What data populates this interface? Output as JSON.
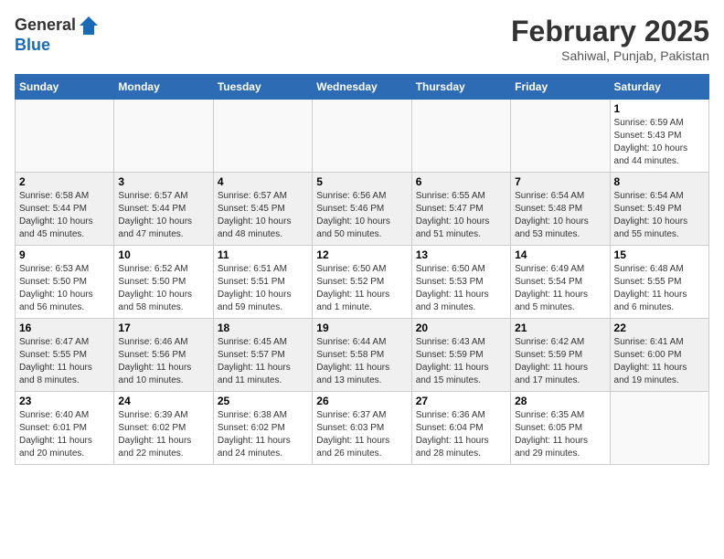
{
  "header": {
    "logo_general": "General",
    "logo_blue": "Blue",
    "month_title": "February 2025",
    "location": "Sahiwal, Punjab, Pakistan"
  },
  "days_of_week": [
    "Sunday",
    "Monday",
    "Tuesday",
    "Wednesday",
    "Thursday",
    "Friday",
    "Saturday"
  ],
  "weeks": [
    {
      "shaded": false,
      "days": [
        {
          "num": "",
          "info": ""
        },
        {
          "num": "",
          "info": ""
        },
        {
          "num": "",
          "info": ""
        },
        {
          "num": "",
          "info": ""
        },
        {
          "num": "",
          "info": ""
        },
        {
          "num": "",
          "info": ""
        },
        {
          "num": "1",
          "info": "Sunrise: 6:59 AM\nSunset: 5:43 PM\nDaylight: 10 hours\nand 44 minutes."
        }
      ]
    },
    {
      "shaded": true,
      "days": [
        {
          "num": "2",
          "info": "Sunrise: 6:58 AM\nSunset: 5:44 PM\nDaylight: 10 hours\nand 45 minutes."
        },
        {
          "num": "3",
          "info": "Sunrise: 6:57 AM\nSunset: 5:44 PM\nDaylight: 10 hours\nand 47 minutes."
        },
        {
          "num": "4",
          "info": "Sunrise: 6:57 AM\nSunset: 5:45 PM\nDaylight: 10 hours\nand 48 minutes."
        },
        {
          "num": "5",
          "info": "Sunrise: 6:56 AM\nSunset: 5:46 PM\nDaylight: 10 hours\nand 50 minutes."
        },
        {
          "num": "6",
          "info": "Sunrise: 6:55 AM\nSunset: 5:47 PM\nDaylight: 10 hours\nand 51 minutes."
        },
        {
          "num": "7",
          "info": "Sunrise: 6:54 AM\nSunset: 5:48 PM\nDaylight: 10 hours\nand 53 minutes."
        },
        {
          "num": "8",
          "info": "Sunrise: 6:54 AM\nSunset: 5:49 PM\nDaylight: 10 hours\nand 55 minutes."
        }
      ]
    },
    {
      "shaded": false,
      "days": [
        {
          "num": "9",
          "info": "Sunrise: 6:53 AM\nSunset: 5:50 PM\nDaylight: 10 hours\nand 56 minutes."
        },
        {
          "num": "10",
          "info": "Sunrise: 6:52 AM\nSunset: 5:50 PM\nDaylight: 10 hours\nand 58 minutes."
        },
        {
          "num": "11",
          "info": "Sunrise: 6:51 AM\nSunset: 5:51 PM\nDaylight: 10 hours\nand 59 minutes."
        },
        {
          "num": "12",
          "info": "Sunrise: 6:50 AM\nSunset: 5:52 PM\nDaylight: 11 hours\nand 1 minute."
        },
        {
          "num": "13",
          "info": "Sunrise: 6:50 AM\nSunset: 5:53 PM\nDaylight: 11 hours\nand 3 minutes."
        },
        {
          "num": "14",
          "info": "Sunrise: 6:49 AM\nSunset: 5:54 PM\nDaylight: 11 hours\nand 5 minutes."
        },
        {
          "num": "15",
          "info": "Sunrise: 6:48 AM\nSunset: 5:55 PM\nDaylight: 11 hours\nand 6 minutes."
        }
      ]
    },
    {
      "shaded": true,
      "days": [
        {
          "num": "16",
          "info": "Sunrise: 6:47 AM\nSunset: 5:55 PM\nDaylight: 11 hours\nand 8 minutes."
        },
        {
          "num": "17",
          "info": "Sunrise: 6:46 AM\nSunset: 5:56 PM\nDaylight: 11 hours\nand 10 minutes."
        },
        {
          "num": "18",
          "info": "Sunrise: 6:45 AM\nSunset: 5:57 PM\nDaylight: 11 hours\nand 11 minutes."
        },
        {
          "num": "19",
          "info": "Sunrise: 6:44 AM\nSunset: 5:58 PM\nDaylight: 11 hours\nand 13 minutes."
        },
        {
          "num": "20",
          "info": "Sunrise: 6:43 AM\nSunset: 5:59 PM\nDaylight: 11 hours\nand 15 minutes."
        },
        {
          "num": "21",
          "info": "Sunrise: 6:42 AM\nSunset: 5:59 PM\nDaylight: 11 hours\nand 17 minutes."
        },
        {
          "num": "22",
          "info": "Sunrise: 6:41 AM\nSunset: 6:00 PM\nDaylight: 11 hours\nand 19 minutes."
        }
      ]
    },
    {
      "shaded": false,
      "days": [
        {
          "num": "23",
          "info": "Sunrise: 6:40 AM\nSunset: 6:01 PM\nDaylight: 11 hours\nand 20 minutes."
        },
        {
          "num": "24",
          "info": "Sunrise: 6:39 AM\nSunset: 6:02 PM\nDaylight: 11 hours\nand 22 minutes."
        },
        {
          "num": "25",
          "info": "Sunrise: 6:38 AM\nSunset: 6:02 PM\nDaylight: 11 hours\nand 24 minutes."
        },
        {
          "num": "26",
          "info": "Sunrise: 6:37 AM\nSunset: 6:03 PM\nDaylight: 11 hours\nand 26 minutes."
        },
        {
          "num": "27",
          "info": "Sunrise: 6:36 AM\nSunset: 6:04 PM\nDaylight: 11 hours\nand 28 minutes."
        },
        {
          "num": "28",
          "info": "Sunrise: 6:35 AM\nSunset: 6:05 PM\nDaylight: 11 hours\nand 29 minutes."
        },
        {
          "num": "",
          "info": ""
        }
      ]
    }
  ]
}
